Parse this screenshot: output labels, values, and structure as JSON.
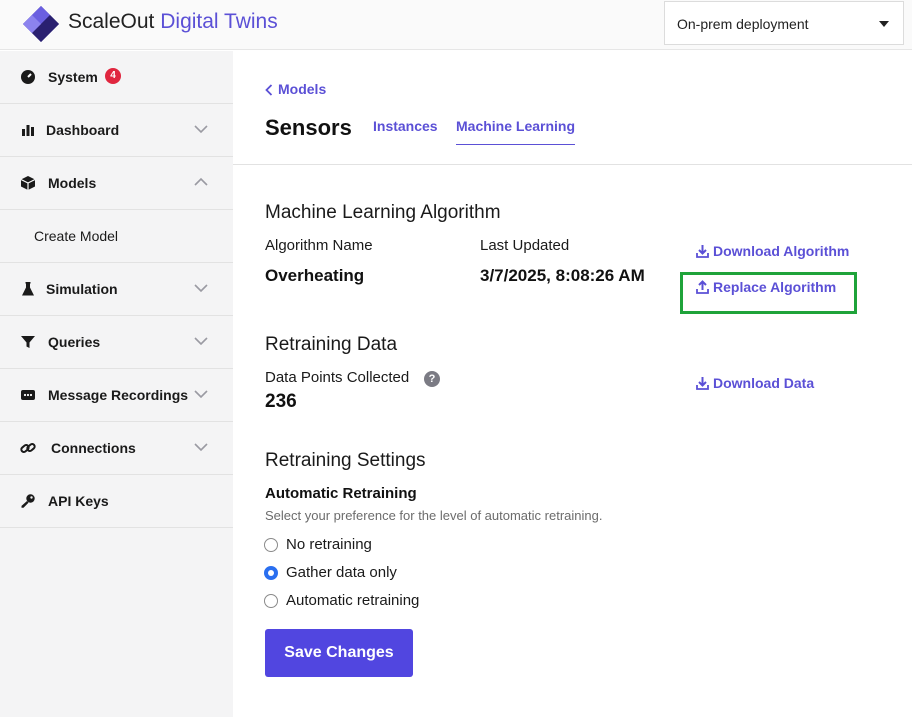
{
  "app": {
    "brand_part1": "ScaleOut",
    "brand_part2": "Digital Twins",
    "deployment_select": "On-prem deployment",
    "accent_color": "#5b50d6",
    "highlight_color": "#1fa33a"
  },
  "sidebar": {
    "items": [
      {
        "label": "System",
        "icon": "speedometer-icon",
        "badge": "4"
      },
      {
        "label": "Dashboard",
        "icon": "bar-chart-icon",
        "expanded": false
      },
      {
        "label": "Models",
        "icon": "cube-icon",
        "expanded": true
      },
      {
        "label": "Simulation",
        "icon": "flask-icon",
        "expanded": false
      },
      {
        "label": "Queries",
        "icon": "filter-icon",
        "expanded": false
      },
      {
        "label": "Message Recordings",
        "icon": "message-icon",
        "expanded": false
      },
      {
        "label": "Connections",
        "icon": "link-icon",
        "expanded": false
      },
      {
        "label": "API Keys",
        "icon": "key-icon"
      }
    ],
    "models_sub": {
      "label": "Create Model"
    }
  },
  "header": {
    "back_label": "Models",
    "title": "Sensors",
    "tabs": [
      {
        "label": "Instances",
        "active": false
      },
      {
        "label": "Machine Learning",
        "active": true
      }
    ]
  },
  "ml": {
    "section_title": "Machine Learning Algorithm",
    "algorithm_name_label": "Algorithm Name",
    "algorithm_name": "Overheating",
    "last_updated_label": "Last Updated",
    "last_updated": "3/7/2025, 8:08:26 AM",
    "download_algorithm": "Download Algorithm",
    "replace_algorithm": "Replace Algorithm"
  },
  "retraining_data": {
    "section_title": "Retraining Data",
    "points_label": "Data Points Collected",
    "points_value": "236",
    "help_glyph": "?",
    "download_data": "Download Data"
  },
  "retraining_settings": {
    "section_title": "Retraining Settings",
    "subheading": "Automatic Retraining",
    "hint": "Select your preference for the level of automatic retraining.",
    "options": [
      {
        "label": "No retraining",
        "selected": false
      },
      {
        "label": "Gather data only",
        "selected": true
      },
      {
        "label": "Automatic retraining",
        "selected": false
      }
    ],
    "save_label": "Save Changes"
  }
}
